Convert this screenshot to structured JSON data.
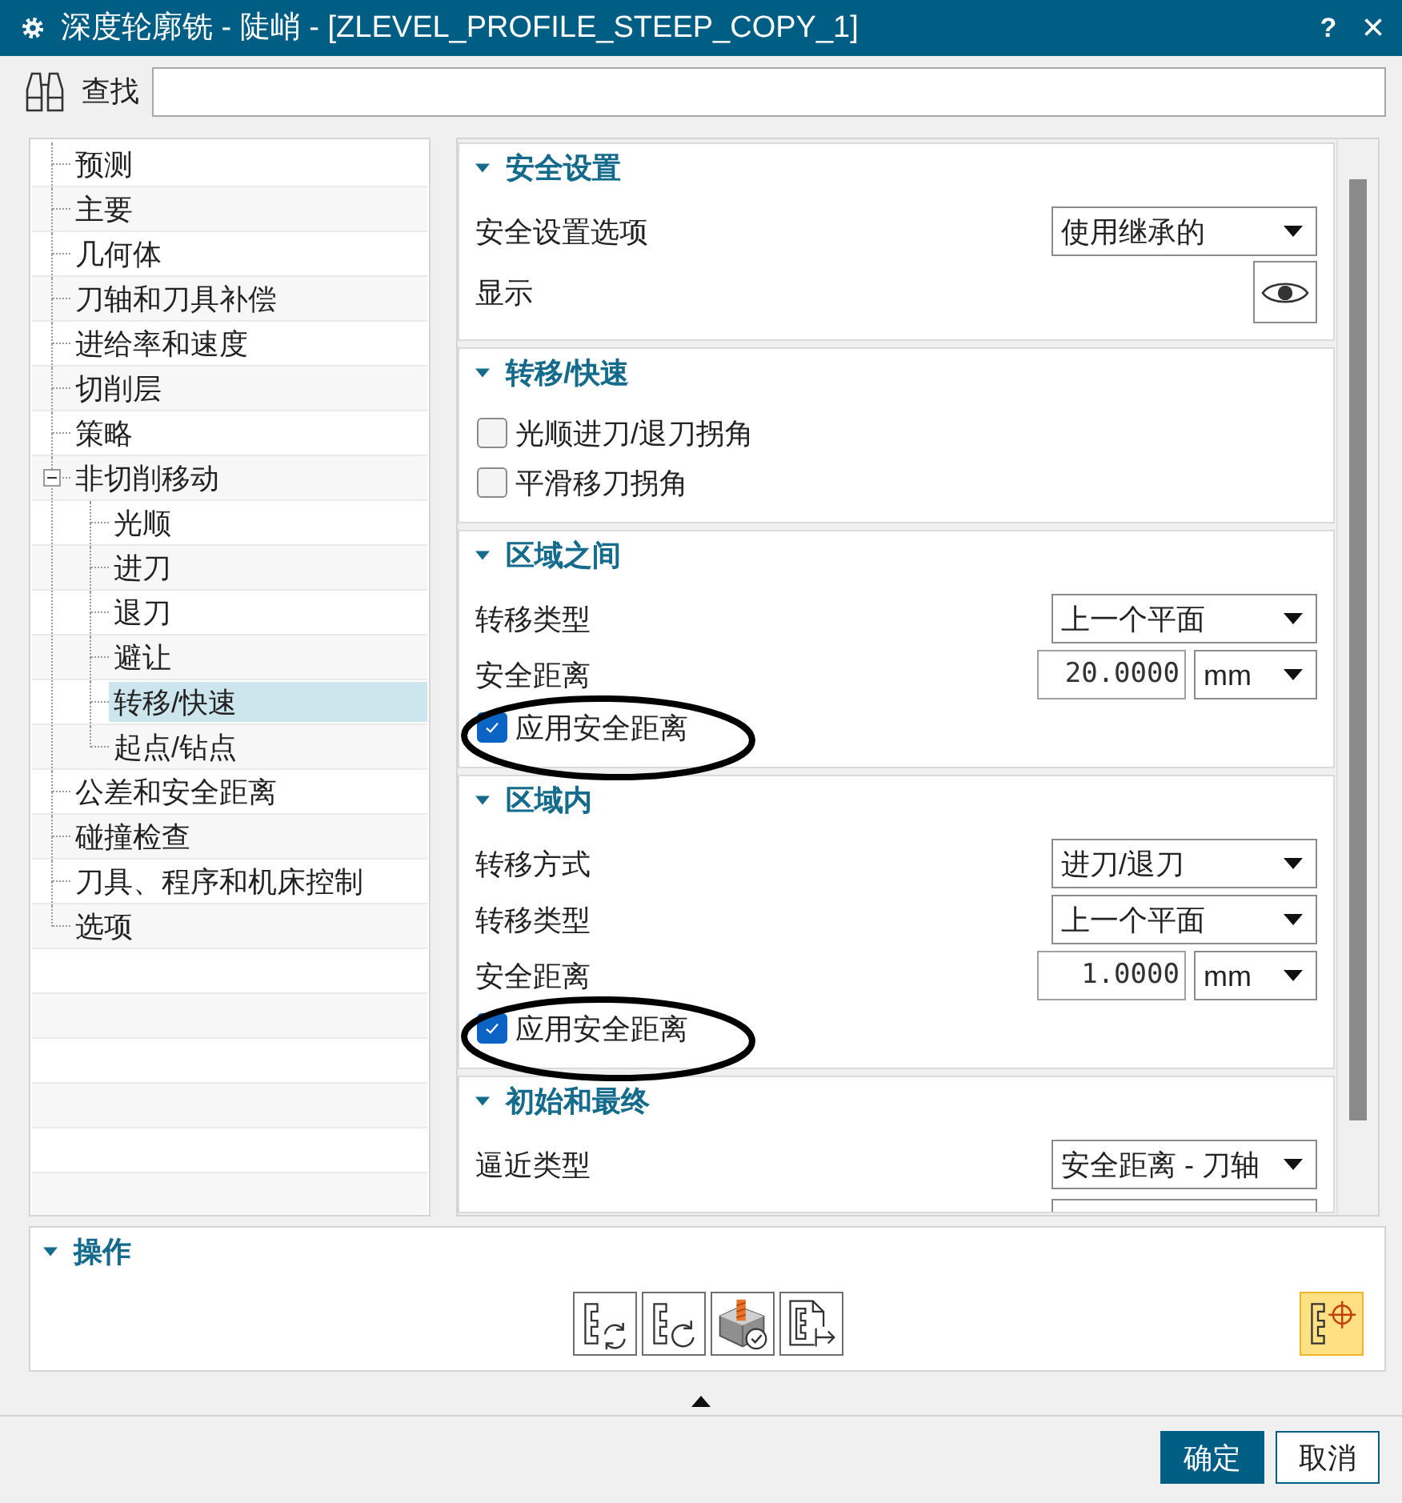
{
  "window": {
    "title": "深度轮廓铣 - 陡峭 - [ZLEVEL_PROFILE_STEEP_COPY_1]",
    "buttons": [
      {
        "kind": "help",
        "label": "?"
      },
      {
        "kind": "close",
        "label": "×"
      }
    ]
  },
  "search": {
    "label": "查找"
  },
  "tree": [
    {
      "label": "预测",
      "selected": false
    },
    {
      "label": "主要",
      "selected": false
    },
    {
      "label": "几何体",
      "selected": false
    },
    {
      "label": "刀轴和刀具补偿",
      "selected": false
    },
    {
      "label": "进给率和速度",
      "selected": false
    },
    {
      "label": "切削层",
      "selected": false
    },
    {
      "label": "策略",
      "selected": false
    },
    {
      "label": "非切削移动",
      "selected": false,
      "expanded": true,
      "children": [
        {
          "label": "光顺",
          "selected": false
        },
        {
          "label": "进刀",
          "selected": false
        },
        {
          "label": "退刀",
          "selected": false
        },
        {
          "label": "避让",
          "selected": false
        },
        {
          "label": "转移/快速",
          "selected": true
        },
        {
          "label": "起点/钻点",
          "selected": false
        }
      ]
    },
    {
      "label": "公差和安全距离",
      "selected": false
    },
    {
      "label": "碰撞检查",
      "selected": false
    },
    {
      "label": "刀具、程序和机床控制",
      "selected": false
    },
    {
      "label": "选项",
      "selected": false
    }
  ],
  "sections": [
    {
      "title": "安全设置",
      "expanded": true,
      "rows": [
        {
          "kind": "dropdown",
          "label": "安全设置选项",
          "value": "使用继承的"
        },
        {
          "kind": "display",
          "label": "显示"
        }
      ]
    },
    {
      "title": "转移/快速",
      "expanded": true,
      "rows": [
        {
          "kind": "checkbox",
          "label": "光顺进刀/退刀拐角",
          "checked": false,
          "circled": false
        },
        {
          "kind": "checkbox",
          "label": "平滑移刀拐角",
          "checked": false,
          "circled": false
        }
      ]
    },
    {
      "title": "区域之间",
      "expanded": true,
      "rows": [
        {
          "kind": "dropdown",
          "label": "转移类型",
          "value": "上一个平面"
        },
        {
          "kind": "distance",
          "label": "安全距离",
          "value": "20.0000",
          "unit": "mm"
        },
        {
          "kind": "checkbox",
          "label": "应用安全距离",
          "checked": true,
          "circled": true
        }
      ]
    },
    {
      "title": "区域内",
      "expanded": true,
      "rows": [
        {
          "kind": "dropdown",
          "label": "转移方式",
          "value": "进刀/退刀"
        },
        {
          "kind": "dropdown",
          "label": "转移类型",
          "value": "上一个平面"
        },
        {
          "kind": "distance",
          "label": "安全距离",
          "value": "1.0000",
          "unit": "mm"
        },
        {
          "kind": "checkbox",
          "label": "应用安全距离",
          "checked": true,
          "circled": true
        }
      ]
    },
    {
      "title": "初始和最终",
      "expanded": true,
      "rows": [
        {
          "kind": "dropdown",
          "label": "逼近类型",
          "value": "安全距离 - 刀轴"
        },
        {
          "kind": "cut_dropdown"
        }
      ]
    }
  ],
  "operations": {
    "title": "操作",
    "expanded": true,
    "actions": [
      {
        "kind": "generate"
      },
      {
        "kind": "replay"
      },
      {
        "kind": "verify"
      },
      {
        "kind": "list"
      }
    ],
    "display_toggle": {
      "on": true
    }
  },
  "buttons": [
    {
      "kind": "primary",
      "label": "确定"
    },
    {
      "kind": "secondary",
      "label": "取消"
    }
  ]
}
